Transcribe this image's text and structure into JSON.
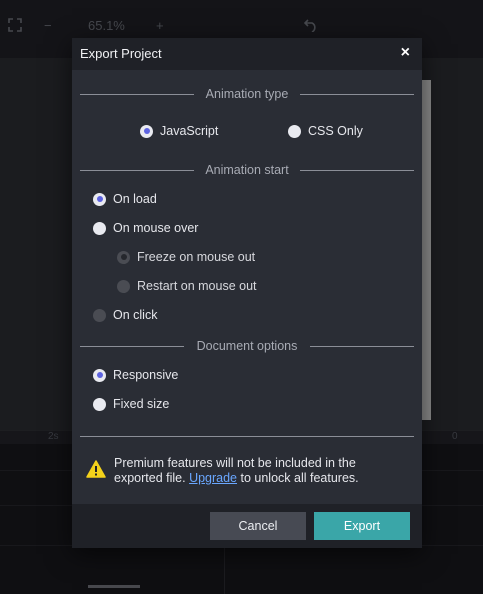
{
  "toolbar": {
    "zoom": "65.1%",
    "minus": "−",
    "plus": "+"
  },
  "timeline": {
    "ruler_left": "2s",
    "ruler_right": "0"
  },
  "dialog": {
    "title": "Export Project",
    "close_label": "×",
    "sections": {
      "animation_type": "Animation type",
      "animation_start": "Animation start",
      "document_options": "Document options"
    },
    "animation_type": {
      "javascript": "JavaScript",
      "css_only": "CSS Only",
      "selected": "JavaScript"
    },
    "animation_start": {
      "on_load": "On load",
      "on_mouse_over": "On mouse over",
      "freeze": "Freeze on mouse out",
      "restart": "Restart on mouse out",
      "on_click": "On click",
      "selected": "On load"
    },
    "document_options": {
      "responsive": "Responsive",
      "fixed_size": "Fixed size",
      "selected": "Responsive"
    },
    "notice": {
      "before": "Premium features will not be included in the exported file.",
      "link": "Upgrade",
      "after": "to unlock all features."
    },
    "buttons": {
      "cancel": "Cancel",
      "export": "Export"
    }
  },
  "colors": {
    "accent_radio": "#5d63e0",
    "export_button": "#3aa6a8",
    "link": "#6aa7ff",
    "warning": "#f4d21b"
  }
}
